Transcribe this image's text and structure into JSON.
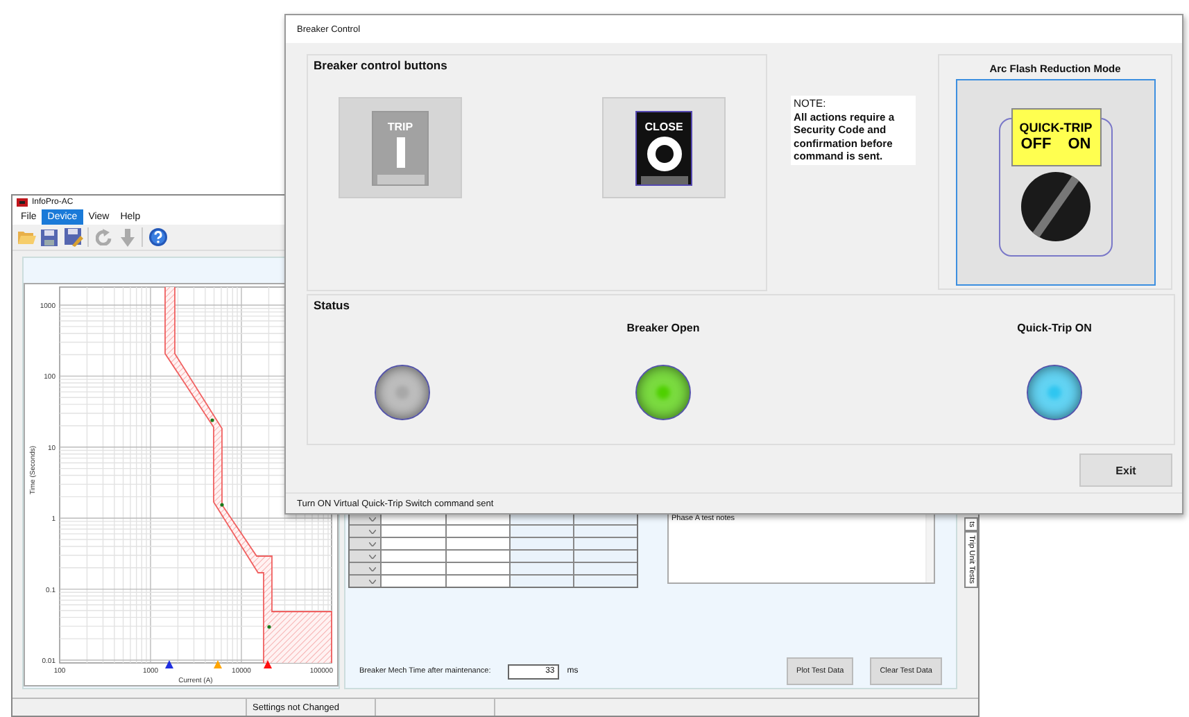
{
  "background_window": {
    "title": "InfoPro-AC",
    "menu": [
      {
        "label": "File",
        "selected": false
      },
      {
        "label": "Device",
        "selected": true
      },
      {
        "label": "View",
        "selected": false
      },
      {
        "label": "Help",
        "selected": false
      }
    ],
    "chart": {
      "ylabel": "Time (Seconds)",
      "xlabel": "Current (A)",
      "yticks": [
        "1000",
        "100",
        "10",
        "1",
        "0.1",
        "0.01"
      ],
      "xticks": [
        "100",
        "1000",
        "10000",
        "100000"
      ],
      "markers": [
        {
          "color": "#1f2fe0"
        },
        {
          "color": "#ffa500"
        },
        {
          "color": "#ff1010"
        }
      ]
    },
    "notes": {
      "value": "Phase A test notes"
    },
    "side_tabs": [
      {
        "label": "ts"
      },
      {
        "label": "Trip Unit Tests"
      }
    ],
    "mech_time": {
      "label": "Breaker Mech Time after maintenance:",
      "value": "33",
      "unit": "ms"
    },
    "buttons": [
      "Plot Test Data",
      "Clear Test Data"
    ],
    "status_bar": [
      "Settings not Changed"
    ]
  },
  "dialog": {
    "title": "Breaker Control",
    "control_group": {
      "title": "Breaker control buttons",
      "buttons": [
        {
          "kind": "trip",
          "label": "TRIP",
          "disabled": true
        },
        {
          "kind": "close",
          "label": "CLOSE",
          "disabled": false
        }
      ]
    },
    "note": {
      "title": "NOTE:",
      "text": "All actions require a Security Code and confirmation before command is sent."
    },
    "arc_flash": {
      "title": "Arc Flash Reduction Mode",
      "switch": {
        "label": "QUICK-TRIP",
        "off_label": "OFF",
        "on_label": "ON",
        "on": true
      }
    },
    "status": {
      "title": "Status",
      "lamps": [
        {
          "color": "#a8a8a8"
        },
        {
          "label": "Breaker Open",
          "color": "#4fd000"
        },
        {
          "label": "Quick-Trip ON",
          "color": "#2fc6f0"
        }
      ]
    },
    "exit_button": "Exit",
    "status_text": "Turn ON Virtual Quick-Trip Switch command sent"
  }
}
